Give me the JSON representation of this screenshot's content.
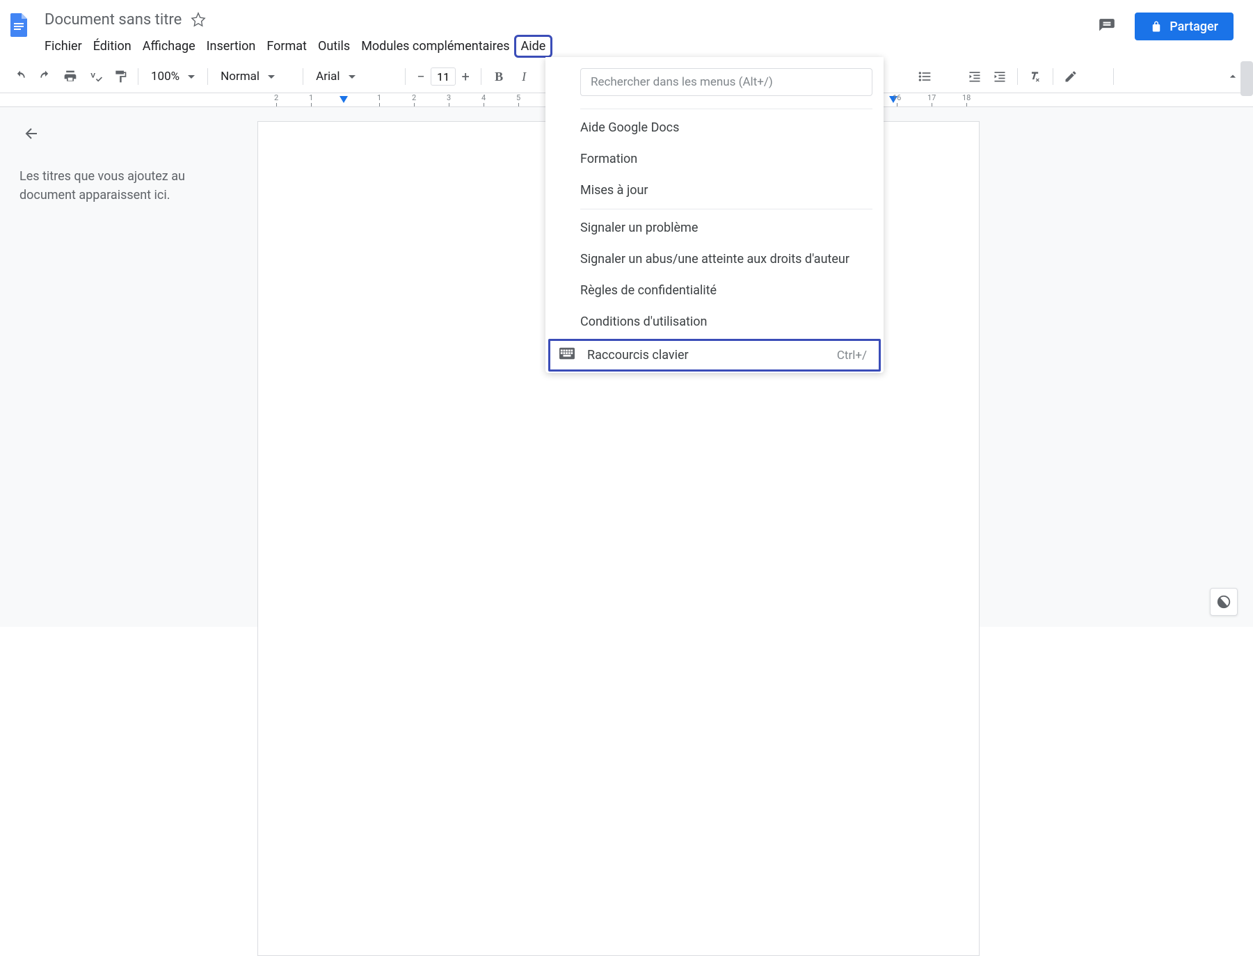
{
  "doc_title": "Document sans titre",
  "menubar": {
    "file": "Fichier",
    "edit": "Édition",
    "view": "Affichage",
    "insert": "Insertion",
    "format": "Format",
    "tools": "Outils",
    "addons": "Modules complémentaires",
    "help": "Aide"
  },
  "share_label": "Partager",
  "toolbar": {
    "zoom": "100%",
    "style": "Normal",
    "font": "Arial",
    "font_size": "11"
  },
  "ruler": {
    "ticks_left": [
      "2",
      "1"
    ],
    "ticks_right": [
      "1",
      "2",
      "3",
      "4",
      "5",
      "16",
      "17",
      "18"
    ]
  },
  "outline": {
    "empty_text": "Les titres que vous ajoutez au document apparaissent ici."
  },
  "help_menu": {
    "search_placeholder": "Rechercher dans les menus (Alt+/)",
    "items1": [
      "Aide Google Docs",
      "Formation",
      "Mises à jour"
    ],
    "items2": [
      "Signaler un problème",
      "Signaler un abus/une atteinte aux droits d'auteur",
      "Règles de confidentialité",
      "Conditions d'utilisation"
    ],
    "shortcuts_label": "Raccourcis clavier",
    "shortcuts_key": "Ctrl+/"
  }
}
